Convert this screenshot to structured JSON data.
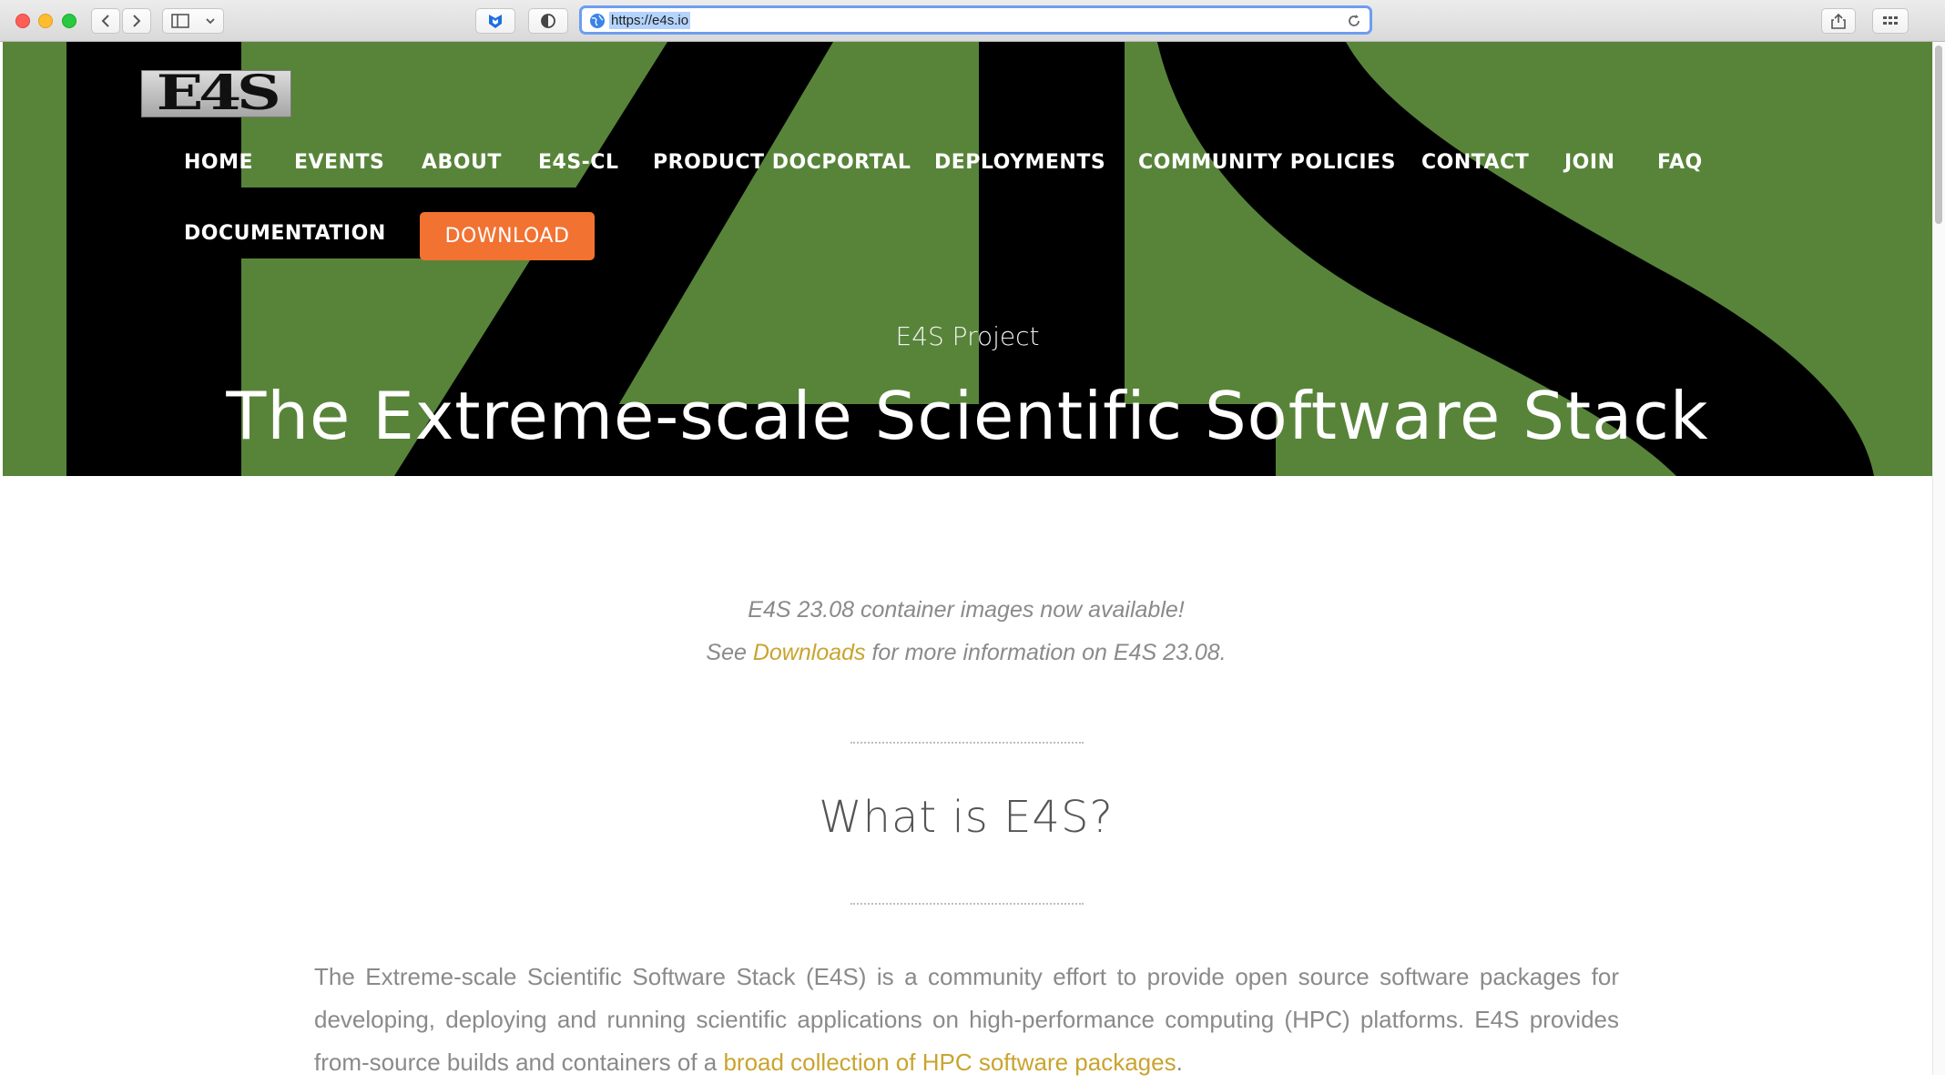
{
  "browser": {
    "url": "https://e4s.io",
    "icons": {
      "back": "chevron-left-icon",
      "forward": "chevron-right-icon",
      "sidebar": "sidebar-icon",
      "extension": "shield-extension-icon",
      "privacy": "half-circle-icon",
      "reload": "reload-icon",
      "share": "share-icon",
      "tabs": "tab-overview-icon",
      "new_tab": "+"
    }
  },
  "site": {
    "logo_text": "E4S",
    "nav": [
      "HOME",
      "EVENTS",
      "ABOUT",
      "E4S-CL",
      "PRODUCT DOCPORTAL",
      "DEPLOYMENTS",
      "COMMUNITY POLICIES",
      "CONTACT",
      "JOIN",
      "FAQ",
      "DOCUMENTATION"
    ],
    "download_label": "DOWNLOAD",
    "hero_subtitle": "E4S Project",
    "hero_title": "The Extreme-scale Scientific Software Stack"
  },
  "announcement": {
    "line1": "E4S 23.08 container images now available!",
    "line2_prefix": "See ",
    "line2_link": "Downloads",
    "line2_suffix": " for more information on E4S 23.08."
  },
  "section": {
    "heading": "What is E4S?",
    "paragraph_text": "The Extreme-scale Scientific Software Stack (E4S) is a community effort to provide open source software packages for developing, deploying and running scientific applications on high-performance computing (HPC) platforms. E4S provides from-source builds and containers of a ",
    "paragraph_link": "broad collection of HPC software packages",
    "paragraph_end": "."
  },
  "colors": {
    "hero_green": "#58843a",
    "download_orange": "#f27232",
    "link_gold": "#c9a42e",
    "text_gray": "#8a8a8a"
  }
}
